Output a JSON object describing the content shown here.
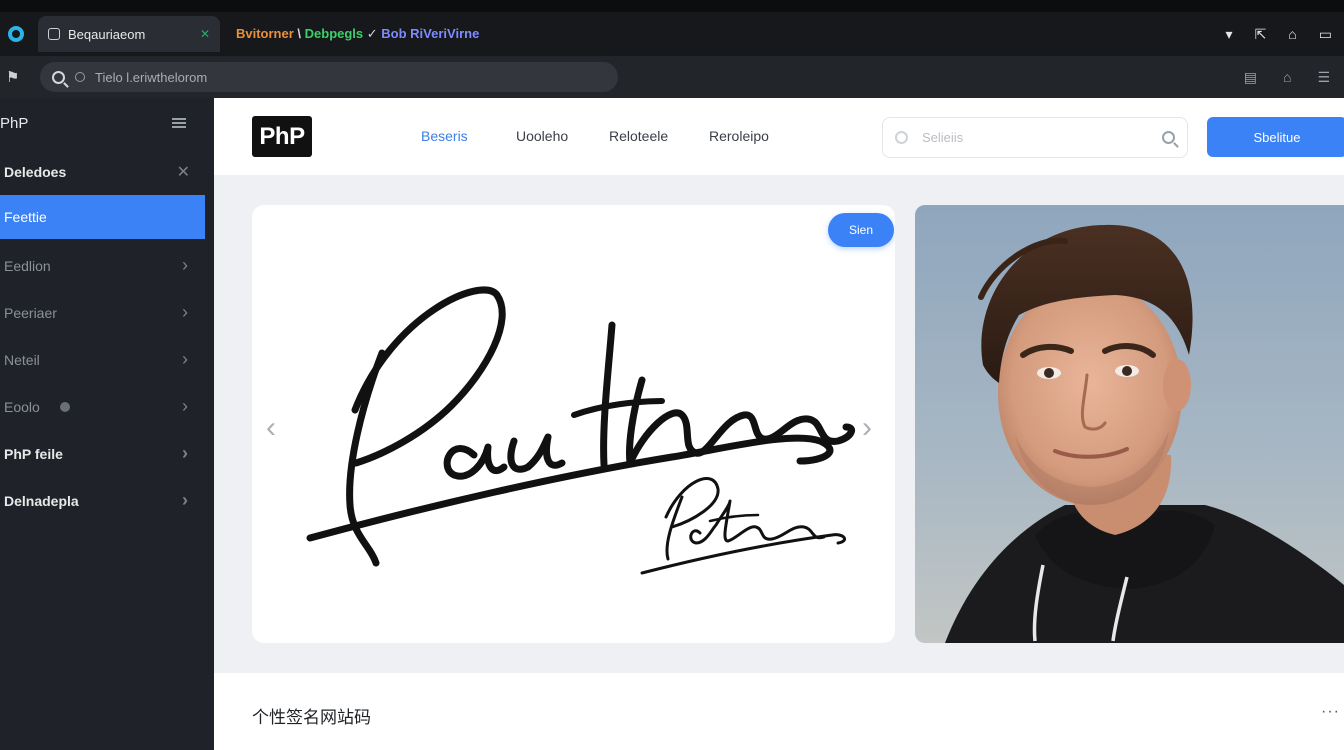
{
  "browser": {
    "active_tab": "Beqauriaeom",
    "inactive_tab": {
      "part1": "Bvitorner",
      "sep1": " \\ ",
      "part2": "Debpegls",
      "sep2": " ✓ ",
      "part3": "Bob RiVeriVirne"
    },
    "address_text": "Tielo l.eriwthelorom"
  },
  "sidebar": {
    "title": "PhP",
    "items": [
      {
        "label": "Deledoes",
        "control": "close"
      },
      {
        "label": "Feettie",
        "control": "none"
      },
      {
        "label": "Eedlion",
        "control": "chevron"
      },
      {
        "label": "Peeriaer",
        "control": "chevron"
      },
      {
        "label": "Neteil",
        "control": "chevron"
      },
      {
        "label": "Eoolo",
        "control": "chevron"
      },
      {
        "label": "PhP feile",
        "control": "chevron"
      },
      {
        "label": "Delnadepla",
        "control": "chevron"
      }
    ]
  },
  "header": {
    "logo": "PhP",
    "nav": [
      "Beseris",
      "Uooleho",
      "Reloteele",
      "Reroleipo"
    ],
    "search_placeholder": "Selieiis",
    "button_label": "Sbelitue"
  },
  "hero": {
    "pill_label": "Sien",
    "signature_large": "Pauthan",
    "signature_small": "Pauthan",
    "prev_arrow": "‹",
    "next_arrow": "›"
  },
  "footer": {
    "site_title": "个性签名网站码",
    "more": "···"
  },
  "colors": {
    "accent": "#3b82f6",
    "sidebar_bg": "#1f2329",
    "page_bg": "#eef0f3"
  }
}
